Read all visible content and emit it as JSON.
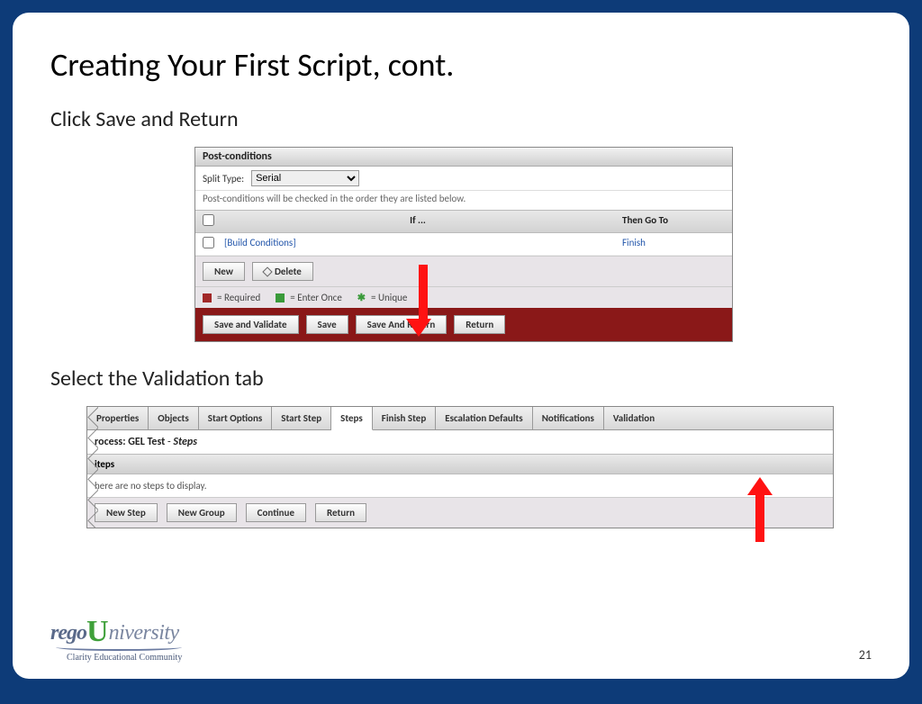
{
  "title": "Creating Your First Script, cont.",
  "sub1": "Click Save and Return",
  "sub2": "Select the Validation tab",
  "panel1": {
    "header": "Post-conditions",
    "splitLabel": "Split Type:",
    "splitValue": "Serial",
    "help": "Post-conditions will be checked in the order they are listed below.",
    "colIf": "If ...",
    "colThen": "Then Go To",
    "buildCond": "[Build Conditions]",
    "finish": "Finish",
    "btnNew": "New",
    "btnDelete": "Delete",
    "legReq": "= Required",
    "legEnter": "= Enter Once",
    "legUnique": "= Unique",
    "btnSaveValidate": "Save and Validate",
    "btnSave": "Save",
    "btnSaveReturn": "Save And Return",
    "btnReturn": "Return"
  },
  "panel2": {
    "tabs": [
      "Properties",
      "Objects",
      "Start Options",
      "Start Step",
      "Steps",
      "Finish Step",
      "Escalation Defaults",
      "Notifications",
      "Validation"
    ],
    "activeTab": 4,
    "procLabel": "rocess: GEL Test",
    "procSuffix": " - ",
    "procItalic": "Steps",
    "stepsHeader": "iteps",
    "noSteps": "here are no steps to display.",
    "btnNewStep": "New Step",
    "btnNewGroup": "New Group",
    "btnContinue": "Continue",
    "btnReturn": "Return"
  },
  "footer": {
    "rego": "rego",
    "u": "U",
    "niv": "niversity",
    "tag": "Clarity Educational Community",
    "page": "21"
  }
}
